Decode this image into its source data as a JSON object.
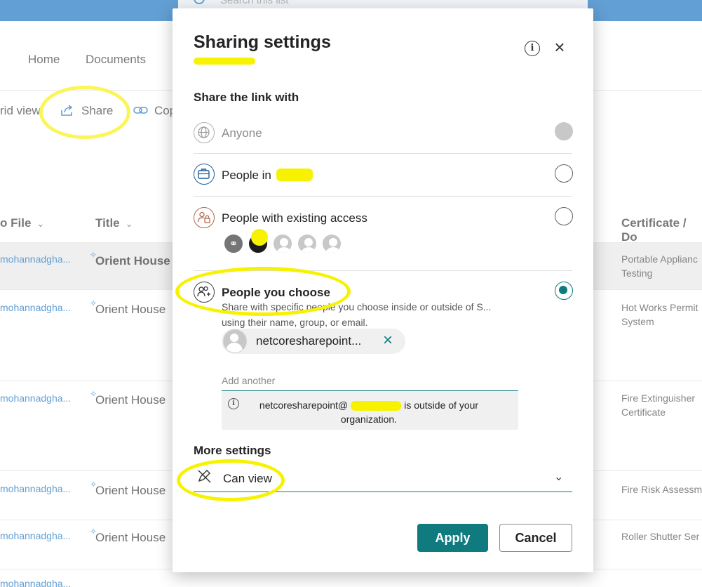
{
  "background": {
    "search_placeholder": "Search this list",
    "nav": [
      "Home",
      "Documents"
    ],
    "commands": {
      "grid_view": "rid view",
      "share": "Share",
      "copy": "Cop"
    },
    "columns": {
      "file": "o File",
      "title": "Title",
      "certificate": "Certificate / Do"
    },
    "rows": [
      {
        "file": "mohannadgha...",
        "title": "Orient House",
        "certificate": "Portable Applianc Testing"
      },
      {
        "file": "mohannadgha...",
        "title": "Orient House",
        "certificate": "Hot Works Permit System"
      },
      {
        "file": "mohannadgha...",
        "title": "Orient House",
        "certificate": "Fire Extinguisher Certificate"
      },
      {
        "file": "mohannadgha...",
        "title": "Orient House",
        "certificate": "Fire Risk Assessme"
      },
      {
        "file": "mohannadgha...",
        "title": "Orient House",
        "certificate": "Roller Shutter Ser"
      },
      {
        "file": "mohannadgha..."
      }
    ]
  },
  "dialog": {
    "title": "Sharing settings",
    "share_with_label": "Share the link with",
    "options": [
      {
        "label": "Anyone",
        "icon": "globe-icon",
        "state": "disabled"
      },
      {
        "label": "People in",
        "icon": "briefcase-icon",
        "state": "unchecked"
      },
      {
        "label": "People with existing access",
        "icon": "people-lock-icon",
        "state": "unchecked"
      },
      {
        "label": "People you choose",
        "icon": "people-add-icon",
        "state": "checked",
        "description": "Share with specific people you choose inside or outside of S... using their name, group, or email."
      }
    ],
    "recipient": "netcoresharepoint...",
    "add_placeholder": "Add another",
    "notice": {
      "prefix": "netcoresharepoint@",
      "suffix": "is outside of your organization."
    },
    "more_settings_label": "More settings",
    "permission": "Can view",
    "apply_label": "Apply",
    "cancel_label": "Cancel",
    "colors": {
      "accent": "#0f7b7f",
      "highlight": "#f7f200",
      "brand_blue": "#0f6cbd"
    }
  }
}
